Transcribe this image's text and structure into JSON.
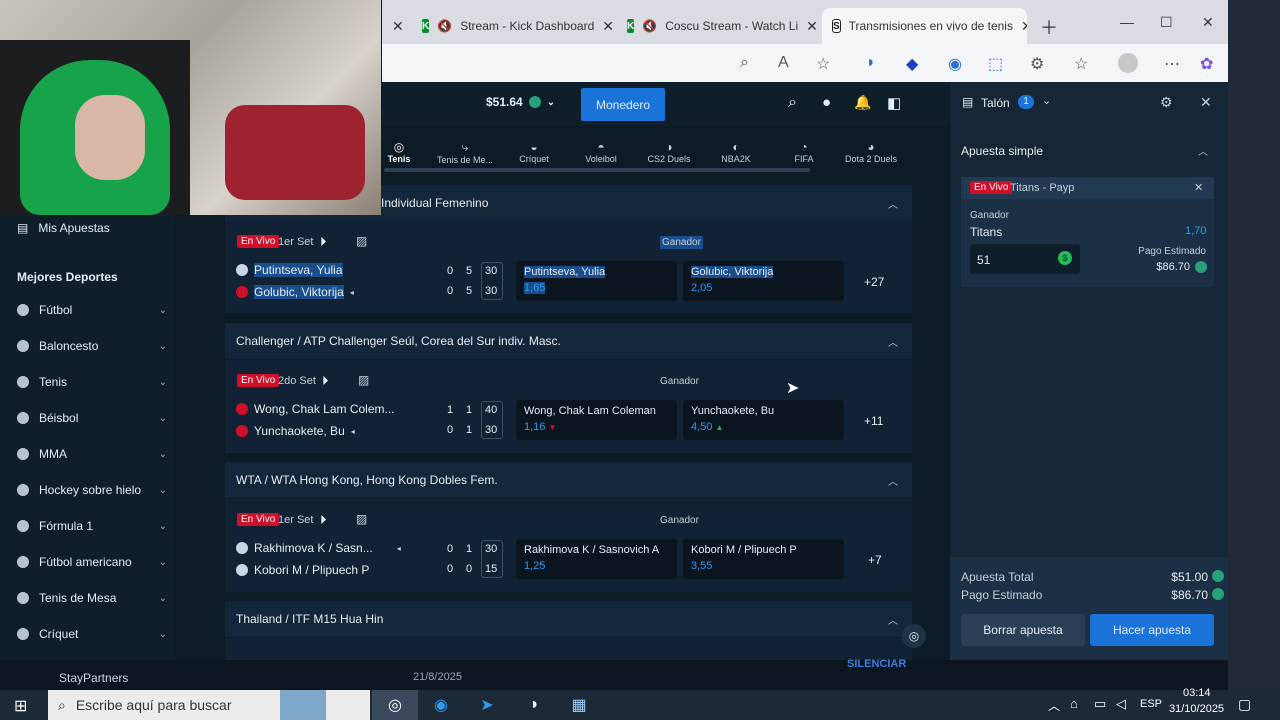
{
  "browser": {
    "tabs": [
      {
        "label": "Stream - Kick Dashboard"
      },
      {
        "label": "Coscu Stream - Watch Li"
      },
      {
        "label": "Transmisiones en vivo de tenis"
      }
    ]
  },
  "header": {
    "balance": "$51.64",
    "wallet_label": "Monedero"
  },
  "sports_tabs": [
    "Tenis",
    "Tenis de Me...",
    "Críquet",
    "Voleibol",
    "CS2 Duels",
    "NBA2K",
    "FIFA",
    "Dota 2 Duels"
  ],
  "sidebar": {
    "my_bets": "Mis Apuestas",
    "heading": "Mejores Deportes",
    "items": [
      {
        "label": "Fútbol"
      },
      {
        "label": "Baloncesto"
      },
      {
        "label": "Tenis"
      },
      {
        "label": "Béisbol"
      },
      {
        "label": "MMA"
      },
      {
        "label": "Hockey sobre hielo"
      },
      {
        "label": "Fórmula 1"
      },
      {
        "label": "Fútbol americano"
      },
      {
        "label": "Tenis de Mesa"
      },
      {
        "label": "Críquet"
      }
    ]
  },
  "live_label": "En Vivo",
  "winner_label": "Ganador",
  "sections": [
    {
      "title": "Individual Femenino",
      "set": "1er Set",
      "players": [
        "Putintseva, Yulia",
        "Golubic, Viktorija"
      ],
      "scores": [
        [
          "0",
          "5",
          "30"
        ],
        [
          "0",
          "5",
          "30"
        ]
      ],
      "odds": [
        {
          "name": "Putintseva, Yulia",
          "value": "1,65"
        },
        {
          "name": "Golubic, Viktorija",
          "value": "2,05"
        }
      ],
      "more": "+27"
    },
    {
      "title": "Challenger / ATP Challenger Seúl, Corea del Sur indiv. Masc.",
      "set": "2do Set",
      "players": [
        "Wong, Chak Lam Colem...",
        "Yunchaokete, Bu"
      ],
      "scores": [
        [
          "1",
          "1",
          "40"
        ],
        [
          "0",
          "1",
          "30"
        ]
      ],
      "odds": [
        {
          "name": "Wong, Chak Lam Coleman",
          "value": "1,16"
        },
        {
          "name": "Yunchaokete, Bu",
          "value": "4,50"
        }
      ],
      "more": "+11"
    },
    {
      "title": "WTA / WTA Hong Kong, Hong Kong Dobles Fem.",
      "set": "1er Set",
      "players": [
        "Rakhimova K / Sasn...",
        "Kobori M / Plipuech P"
      ],
      "scores": [
        [
          "0",
          "1",
          "30"
        ],
        [
          "0",
          "0",
          "15"
        ]
      ],
      "odds": [
        {
          "name": "Rakhimova K / Sasnovich A",
          "value": "1,25"
        },
        {
          "name": "Kobori M / Plipuech P",
          "value": "3,55"
        }
      ],
      "more": "+7"
    },
    {
      "title": "Thailand / ITF M15 Hua Hin"
    }
  ],
  "betslip": {
    "title": "Talón",
    "count": "1",
    "simple": "Apuesta simple",
    "event": "Titans - Payp",
    "market": "Ganador",
    "selection": "Titans",
    "odds": "1,70",
    "est_label": "Pago Estimado",
    "est_value": "$86.70",
    "stake": "51",
    "total_label": "Apuesta Total",
    "total_value": "$51.00",
    "payout_label": "Pago Estimado",
    "payout_value": "$86.70",
    "clear_btn": "Borrar apuesta",
    "place_btn": "Hacer apuesta"
  },
  "stream_overlay": {
    "left": "StayPartners",
    "date": "21/8/2025",
    "right": "SILENCIAR"
  },
  "taskbar": {
    "search": "Escribe aquí para buscar",
    "lang": "ESP",
    "time": "03:14",
    "date": "31/10/2025"
  },
  "colors": {
    "accent": "#1a73d9",
    "live": "#d0102a",
    "odds": "#2e9cf0",
    "panel": "#152636"
  }
}
